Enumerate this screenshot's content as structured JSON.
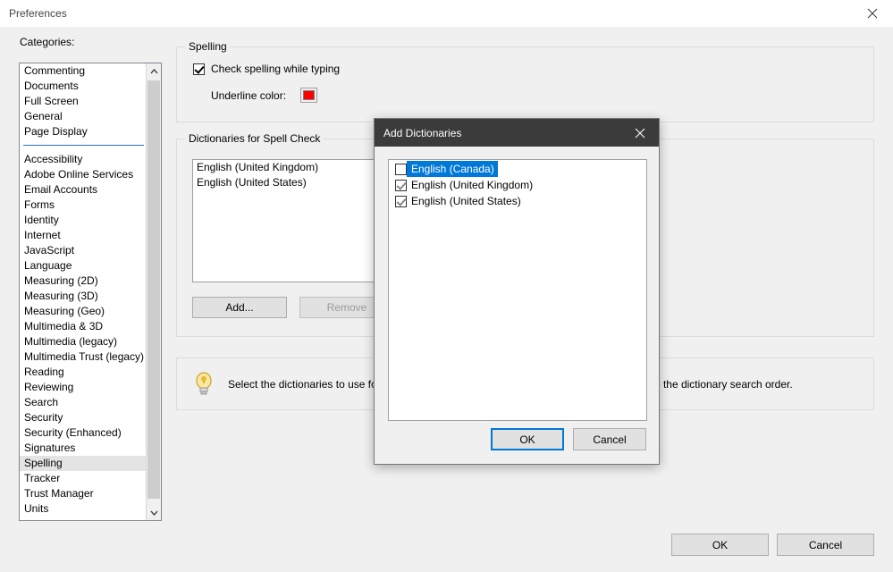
{
  "window": {
    "title": "Preferences",
    "close_icon": "close-icon"
  },
  "categories": {
    "label": "Categories:",
    "selected": "Spelling",
    "items": [
      "Commenting",
      "Documents",
      "Full Screen",
      "General",
      "Page Display",
      "Accessibility",
      "Adobe Online Services",
      "Email Accounts",
      "Forms",
      "Identity",
      "Internet",
      "JavaScript",
      "Language",
      "Measuring (2D)",
      "Measuring (3D)",
      "Measuring (Geo)",
      "Multimedia & 3D",
      "Multimedia (legacy)",
      "Multimedia Trust (legacy)",
      "Reading",
      "Reviewing",
      "Search",
      "Security",
      "Security (Enhanced)",
      "Signatures",
      "Spelling",
      "Tracker",
      "Trust Manager",
      "Units"
    ],
    "separator_after_index": 4,
    "scroll_up_icon": "chevron-up-icon",
    "scroll_down_icon": "chevron-down-icon"
  },
  "spelling_group": {
    "title": "Spelling",
    "check_while_typing_label": "Check spelling while typing",
    "check_while_typing_checked": true,
    "underline_color_label": "Underline color:",
    "underline_color_value": "#FF0000"
  },
  "dictionaries_group": {
    "title": "Dictionaries for Spell Check",
    "items": [
      "English (United Kingdom)",
      "English (United States)"
    ],
    "add_label": "Add...",
    "remove_label": "Remove",
    "remove_disabled": true
  },
  "hint_group": {
    "bulb_icon": "lightbulb-icon",
    "text": "Select the dictionaries to use for spell check, and the order in which they are used to define the dictionary search order."
  },
  "footer": {
    "ok_label": "OK",
    "cancel_label": "Cancel"
  },
  "modal": {
    "title": "Add Dictionaries",
    "close_icon": "close-icon",
    "items": [
      {
        "label": "English (Canada)",
        "checked": false,
        "selected": true
      },
      {
        "label": "English (United Kingdom)",
        "checked": true,
        "selected": false
      },
      {
        "label": "English (United States)",
        "checked": true,
        "selected": false
      }
    ],
    "ok_label": "OK",
    "cancel_label": "Cancel",
    "accent_color": "#0078D7",
    "titlebar_color": "#3B3B3B"
  }
}
